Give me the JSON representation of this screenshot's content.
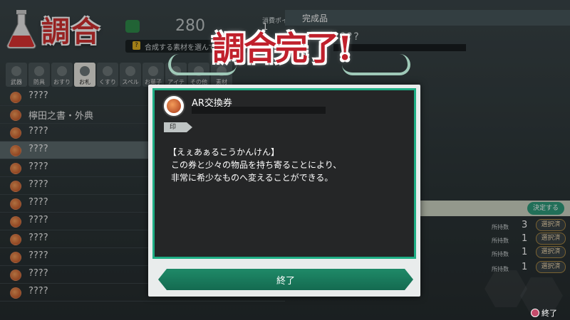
{
  "header": {
    "title": "調合",
    "count": "280",
    "cost_label": "消費ポイント",
    "cost_value": "1",
    "hint": "合成する素材を選んで",
    "done_label": "完成品",
    "done_unknown": "????"
  },
  "categories": [
    {
      "label": "武器",
      "icon": "sword-icon"
    },
    {
      "label": "防具",
      "icon": "armor-icon"
    },
    {
      "label": "おすり",
      "icon": "potion-icon"
    },
    {
      "label": "お札",
      "icon": "charm-icon",
      "selected": true
    },
    {
      "label": "くすり",
      "icon": "medicine-icon"
    },
    {
      "label": "スペル",
      "icon": "spell-icon"
    },
    {
      "label": "お菓子",
      "icon": "sweets-icon"
    },
    {
      "label": "アイテ",
      "icon": "item-icon"
    },
    {
      "label": "その他",
      "icon": "misc-icon"
    },
    {
      "label": "素材",
      "icon": "material-icon"
    }
  ],
  "list": [
    {
      "label": "????"
    },
    {
      "label": "檸田之書・外典"
    },
    {
      "label": "????"
    },
    {
      "label": "????",
      "selected": true
    },
    {
      "label": "????"
    },
    {
      "label": "????"
    },
    {
      "label": "????"
    },
    {
      "label": "????"
    },
    {
      "label": "????"
    },
    {
      "label": "????"
    },
    {
      "label": "????"
    },
    {
      "label": "????"
    }
  ],
  "right": {
    "decide": "決定する",
    "held_label": "所持数",
    "rows": [
      {
        "count": "3",
        "btn": "選択済"
      },
      {
        "count": "1",
        "btn": "選択済"
      },
      {
        "count": "1",
        "btn": "選択済"
      },
      {
        "count": "1",
        "btn": "選択済"
      }
    ],
    "end_hint": "終了"
  },
  "banner": {
    "text": "調合完了!"
  },
  "dialog": {
    "item_name": "AR交換券",
    "tag": "印",
    "desc": [
      "【えぇあぁるこうかんけん】",
      "この券と少々の物品を持ち寄ることにより、",
      "非常に希少なものへ変えることができる。"
    ],
    "ok": "終了"
  }
}
